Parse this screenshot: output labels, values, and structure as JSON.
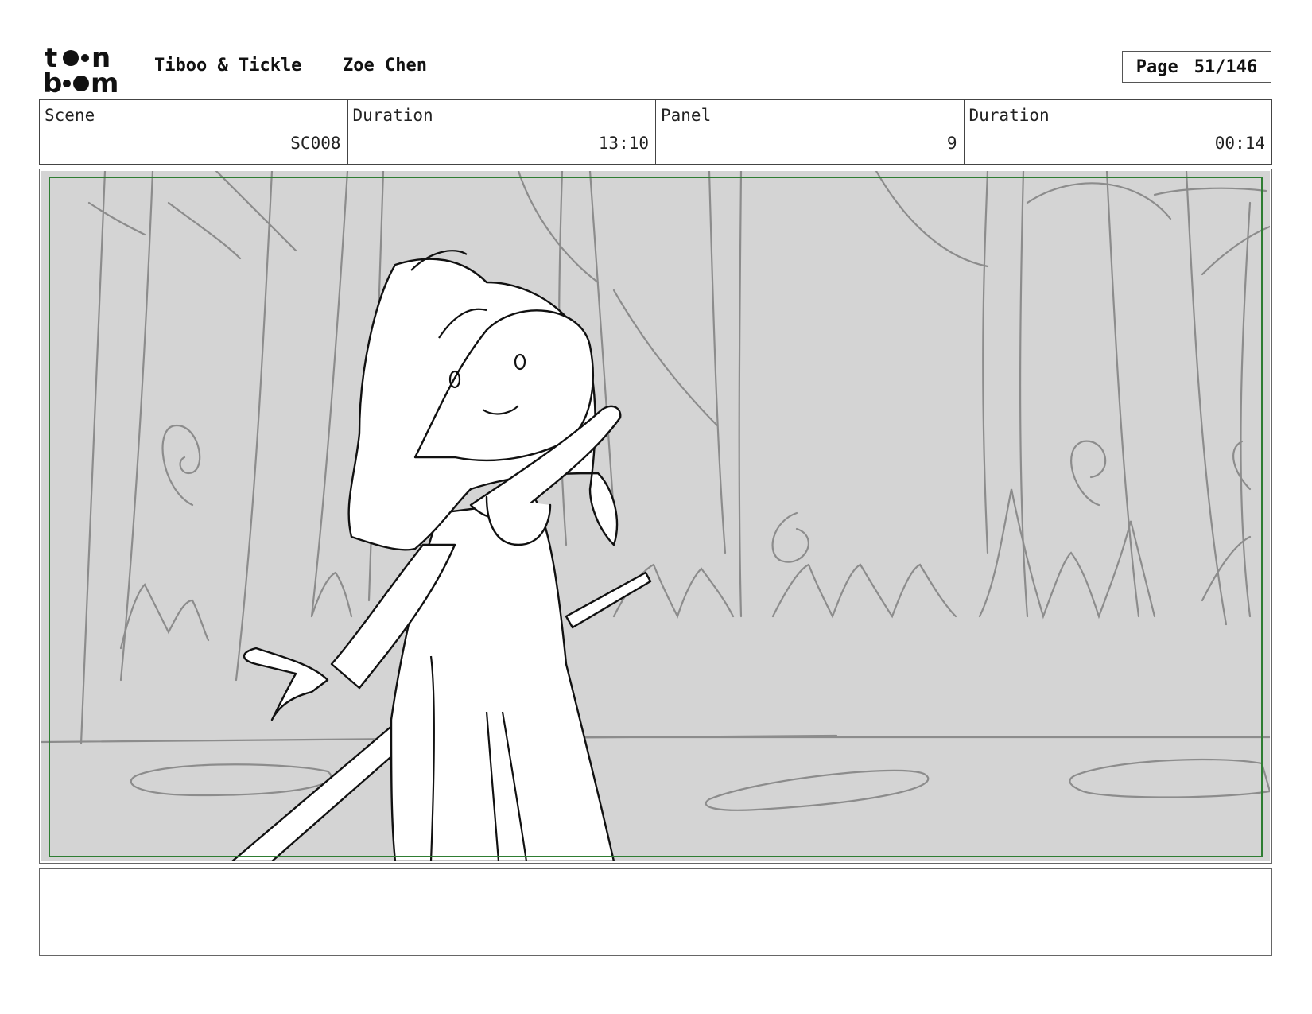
{
  "header": {
    "logo_text": "toon boom",
    "project_title": "Tiboo & Tickle",
    "artist_name": "Zoe Chen",
    "page_label": "Page",
    "page_number": "51/146"
  },
  "info_table": [
    {
      "label": "Scene",
      "value": "SC008"
    },
    {
      "label": "Duration",
      "value": "13:10"
    },
    {
      "label": "Panel",
      "value": "9"
    },
    {
      "label": "Duration",
      "value": "00:14"
    }
  ],
  "panel": {
    "background_color": "#d4d4d4",
    "sketch_line_color": "#8c8c8c",
    "character_line_color": "#111111",
    "safe_frame_color": "#2e7d32"
  },
  "notes": {
    "text": ""
  }
}
